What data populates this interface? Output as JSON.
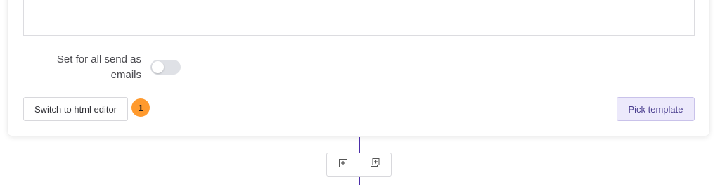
{
  "settings": {
    "send_as_label": "Set for all send as emails",
    "send_as_enabled": false
  },
  "actions": {
    "html_editor_label": "Switch to html editor",
    "step_badge": "1",
    "pick_template_label": "Pick template"
  },
  "node_toolbar": {
    "add_icon": "plus-square-icon",
    "duplicate_icon": "copy-plus-icon"
  },
  "colors": {
    "accent": "#4b2ea8",
    "badge": "#ff9a2e",
    "primary_button_bg": "#ece9fb"
  }
}
